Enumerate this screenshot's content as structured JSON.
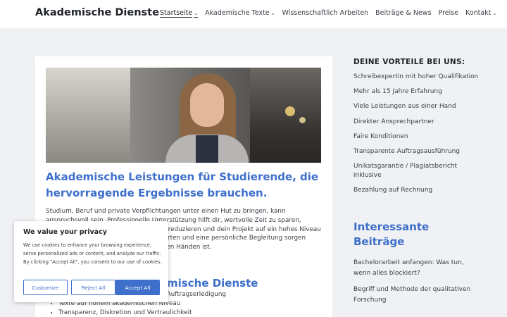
{
  "header": {
    "brand": "Akademische Dienste",
    "nav": [
      {
        "label": "Startseite",
        "chevron": "⌄"
      },
      {
        "label": "Akademische Texte",
        "chevron": "⌄"
      },
      {
        "label": "Wissenschaftlich Arbeiten",
        "chevron": ""
      },
      {
        "label": "Beiträge & News",
        "chevron": ""
      },
      {
        "label": "Preise",
        "chevron": ""
      },
      {
        "label": "Kontakt",
        "chevron": "⌄"
      }
    ]
  },
  "main": {
    "headline": "Akademische Leistungen für Studierende, die hervorragende Ergebnisse brauchen.",
    "intro": "Studium, Beruf und private Verpflichtungen unter einen Hut zu bringen, kann anspruchsvoll sein. Professionelle Unterstützung hilft dir, wertvolle Zeit zu sparen, Lücken im akademischen Schreiben zu reduzieren und dein Projekt auf ein hohes Niveau zu bringen. Unsere ausgebildeten Experten und eine persönliche Begleitung sorgen dafür, dass dein Projekt bei uns in besten Händen ist.",
    "subheading": "ademische Dienste",
    "bullet_first": "che Auftragserledigung",
    "bullets": [
      "Texte auf hohem akademischen Niveau",
      "Transparenz, Diskretion und Vertraulichkeit"
    ]
  },
  "sidebar": {
    "title": "DEINE VORTEILE BEI UNS:",
    "benefits": [
      "Schreibexpertin mit hoher Qualifikation",
      "Mehr als 15 Jahre Erfahrung",
      "Viele Leistungen aus einer Hand",
      "Direkter Ansprechpartner",
      "Faire Konditionen",
      "Transparente Auftragsausführung",
      "Unikatsgarantie / Plagiatsbericht inklusive",
      "Bezahlung auf Rechnung"
    ],
    "posts_title": "Interessante Beiträge",
    "posts": [
      "Bachelorarbeit anfangen: Was tun, wenn alles blockiert?",
      "Begriff und Methode der qualitativen Forschung"
    ]
  },
  "cookie": {
    "title": "We value your privacy",
    "text": "We use cookies to enhance your browsing experience, serve personalized ads or content, and analyze our traffic. By clicking \"Accept All\", you consent to our use of cookies.",
    "customize": "Customize",
    "reject": "Reject All",
    "accept": "Accept All"
  }
}
